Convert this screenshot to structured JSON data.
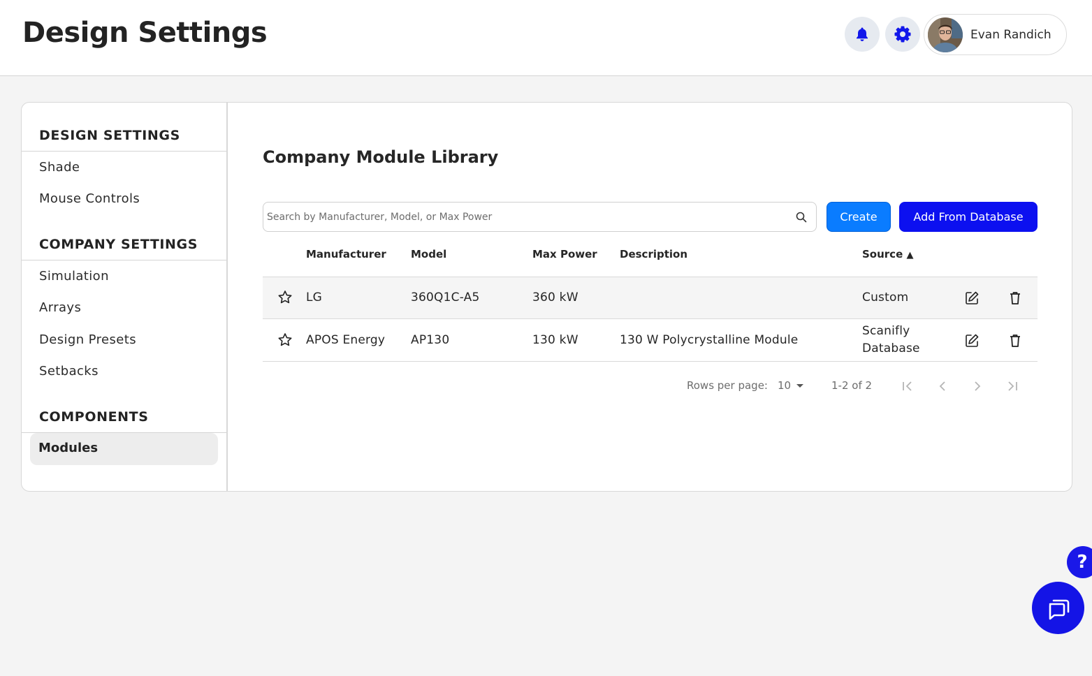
{
  "header": {
    "title": "Design Settings",
    "user_name": "Evan Randich",
    "bell_icon": "bell-icon",
    "gear_icon": "gear-icon",
    "accent": "#0c10f0"
  },
  "sidebar": {
    "sections": [
      {
        "title": "DESIGN SETTINGS",
        "items": [
          "Shade",
          "Mouse Controls"
        ]
      },
      {
        "title": "COMPANY SETTINGS",
        "items": [
          "Simulation",
          "Arrays",
          "Design Presets",
          "Setbacks"
        ]
      },
      {
        "title": "COMPONENTS",
        "items": [
          "Modules"
        ]
      }
    ],
    "active_item": "Modules"
  },
  "main": {
    "title": "Company Module Library",
    "search": {
      "placeholder": "Search by Manufacturer, Model, or Max Power",
      "value": ""
    },
    "create_label": "Create",
    "add_label": "Add From Database"
  },
  "table": {
    "columns": [
      "Manufacturer",
      "Model",
      "Max Power",
      "Description",
      "Source"
    ],
    "sort_indicator": "▲",
    "rows": [
      {
        "manufacturer": "LG",
        "model": "360Q1C-A5",
        "max_power": "360 kW",
        "description": "",
        "source_line1": "Custom",
        "source_line2": ""
      },
      {
        "manufacturer": "APOS Energy",
        "model": "AP130",
        "max_power": "130 kW",
        "description": "130 W Polycrystalline Module",
        "source_line1": "Scanifly",
        "source_line2": "Database"
      }
    ]
  },
  "pagination": {
    "rows_per_page_label": "Rows per page:",
    "rows_per_page": "10",
    "range": "1-2 of 2"
  },
  "floating": {
    "help_label": "?"
  }
}
